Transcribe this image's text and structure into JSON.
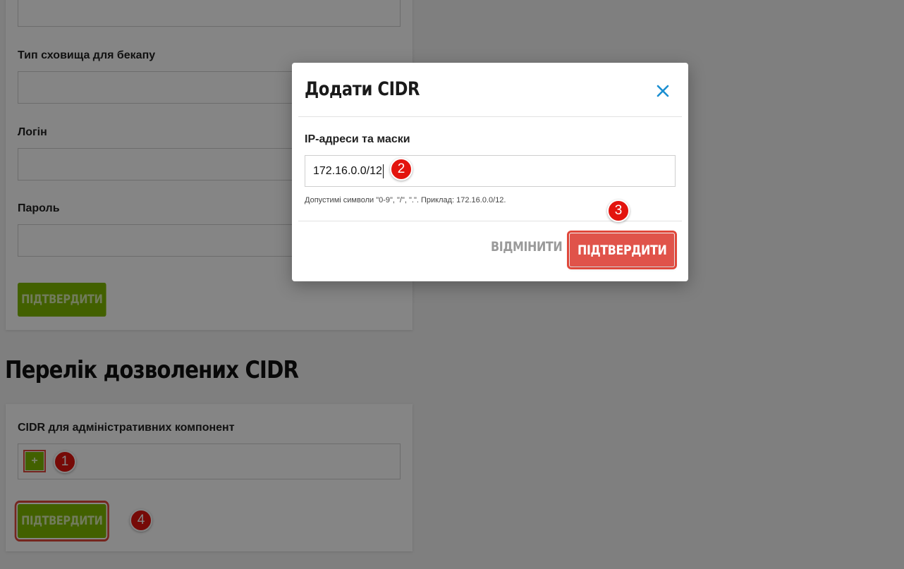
{
  "backup_form": {
    "storage_type_label": "Тип сховища для бекапу",
    "login_label": "Логін",
    "password_label": "Пароль",
    "confirm_label": "ПІДТВЕРДИТИ"
  },
  "cidr_section": {
    "title": "Перелік дозволених CIDR",
    "field_label": "CIDR для адміністративних компонент",
    "add_symbol": "+",
    "confirm_label": "ПІДТВЕРДИТИ"
  },
  "modal": {
    "title": "Додати CIDR",
    "close_icon": "close-icon",
    "field_label": "IP-адреси та маски",
    "input_value": "172.16.0.0/12",
    "hint": "Допустимі символи \"0-9\", \"/\", \".\". Приклад: 172.16.0.0/12.",
    "cancel_label": "ВІДМІНИТИ",
    "confirm_label": "ПІДТВЕРДИТИ"
  },
  "step_markers": [
    "1",
    "2",
    "3",
    "4"
  ],
  "colors": {
    "accent_green": "#7fb800",
    "confirm_red": "#e0534a",
    "marker_red": "#e3140e",
    "close_blue": "#1b8fd1"
  }
}
